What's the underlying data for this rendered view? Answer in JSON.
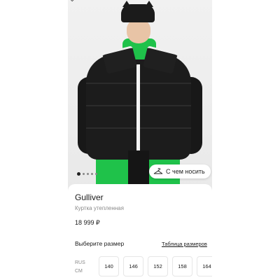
{
  "gallery": {
    "dot_count": 5,
    "active_index": 0
  },
  "style_button": {
    "label": "С чем носить",
    "icon": "hanger-icon"
  },
  "product": {
    "brand": "Gulliver",
    "subtitle": "Куртка утепленная",
    "price": "18 999 ₽"
  },
  "sizes": {
    "title": "Выберите размер",
    "table_link": "Таблица размеров",
    "system_line1": "RUS",
    "system_line2": "СМ",
    "options": [
      "140",
      "146",
      "152",
      "158",
      "164"
    ]
  },
  "colors": {
    "accent_green": "#1fc24a",
    "jacket": "#1c1c1c"
  }
}
